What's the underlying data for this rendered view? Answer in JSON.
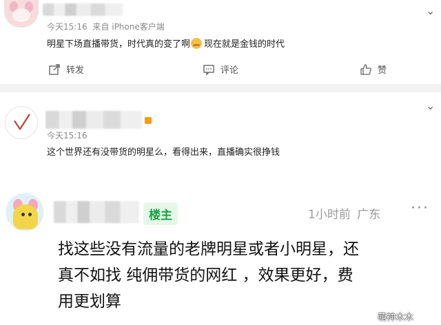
{
  "post1": {
    "time": "今天15:16",
    "source": "来自 iPhone客户端",
    "text_before": "明星下场直播带货，时代真的变了啊",
    "text_after": "现在就是金钱的时代",
    "actions": {
      "forward": "转发",
      "comment": "评论",
      "like": "赞"
    }
  },
  "post2": {
    "time": "今天15:16",
    "text": "这个世界还有没带货的明星么，看得出来，直播确实很挣钱"
  },
  "post3": {
    "owner_badge": "楼主",
    "time": "1小时前",
    "location": "广东",
    "text_line1": "找这些没有流量的老牌明星或者小明星，还",
    "text_line2": "真不如找 纯佣带货的网红 ，效果更好，费",
    "text_line3": "用更划算"
  },
  "watermark": "萌神木木",
  "icons": {
    "more": "chevron-down-icon",
    "forward": "share-icon",
    "comment": "comment-icon",
    "like": "thumbs-up-icon",
    "options": "more-dots-icon"
  },
  "colors": {
    "owner_badge_bg": "#e6f7ea",
    "owner_badge_fg": "#18a33e",
    "separator": "#f2f2f2"
  }
}
